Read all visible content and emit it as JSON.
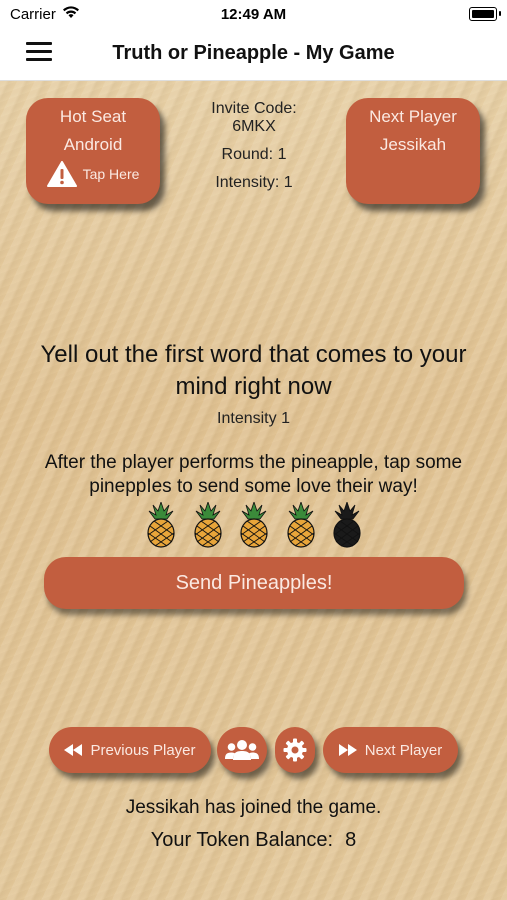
{
  "status_bar": {
    "carrier": "Carrier",
    "time": "12:49 AM"
  },
  "nav": {
    "title": "Truth or Pineapple - My Game"
  },
  "hot_seat_card": {
    "line1": "Hot Seat",
    "line2": "Android",
    "tap_label": "Tap Here"
  },
  "game_info": {
    "invite_label": "Invite Code:",
    "invite_code": "6MKX",
    "round": "Round: 1",
    "intensity": "Intensity: 1"
  },
  "next_player_card": {
    "line1": "Next Player",
    "line2": "Jessikah"
  },
  "prompt": {
    "text": "Yell out the first word that comes to your mind right now",
    "intensity": "Intensity 1"
  },
  "instructions": "After the player performs the pineapple, tap some pineppIes to send some love their way!",
  "pineapples": {
    "selected": 4,
    "total": 5,
    "color_on": "#e8a53a",
    "color_off": "#1a1a1a"
  },
  "send_button": {
    "label": "Send Pineapples!"
  },
  "bottom_nav": {
    "prev_label": "Previous Player",
    "next_label": "Next Player"
  },
  "status_message": "Jessikah has joined the game.",
  "token": {
    "label": "Your Token Balance:",
    "value": "8"
  },
  "colors": {
    "accent": "#c25e3f",
    "sand": "#e6cc9e"
  }
}
